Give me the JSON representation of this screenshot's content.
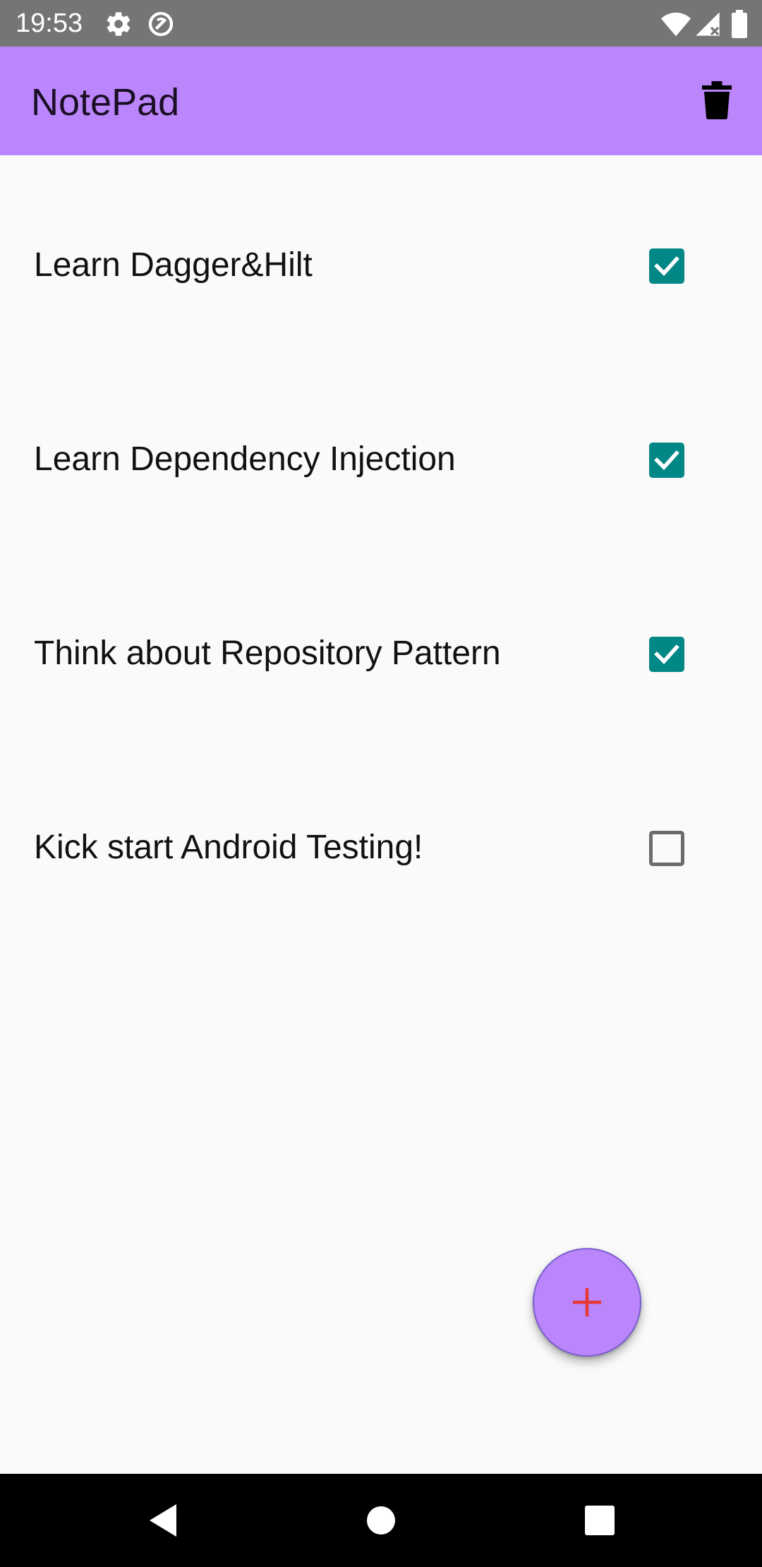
{
  "status_bar": {
    "time": "19:53",
    "left_icons": [
      "settings-icon",
      "data-saver-icon"
    ],
    "right_icons": [
      "wifi-icon",
      "signal-icon",
      "battery-icon"
    ]
  },
  "app_bar": {
    "title": "NotePad",
    "action_icon": "trash-icon",
    "background": "#bb86fc"
  },
  "notes": [
    {
      "text": "Learn Dagger&Hilt",
      "checked": true
    },
    {
      "text": "Learn Dependency Injection",
      "checked": true
    },
    {
      "text": "Think about Repository Pattern",
      "checked": true
    },
    {
      "text": "Kick start Android Testing!",
      "checked": false
    }
  ],
  "fab": {
    "icon": "plus-icon",
    "background": "#bb86fc",
    "icon_color": "#e53935"
  },
  "colors": {
    "checkbox_checked": "#018786",
    "checkbox_unchecked_border": "#6b6b6b"
  },
  "nav_bar": {
    "buttons": [
      "back-icon",
      "home-icon",
      "recents-icon"
    ]
  }
}
